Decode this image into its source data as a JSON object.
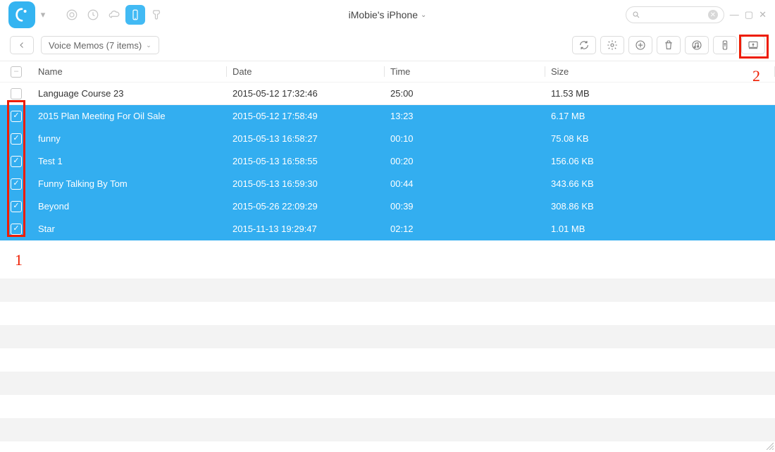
{
  "header": {
    "device_title": "iMobie's iPhone",
    "search_placeholder": ""
  },
  "breadcrumb": {
    "label": "Voice Memos (7 items)"
  },
  "columns": {
    "name": "Name",
    "date": "Date",
    "time": "Time",
    "size": "Size"
  },
  "annotations": {
    "label1": "1",
    "label2": "2"
  },
  "rows": [
    {
      "selected": false,
      "name": "Language Course 23",
      "date": "2015-05-12 17:32:46",
      "time": "25:00",
      "size": "11.53 MB"
    },
    {
      "selected": true,
      "name": "2015 Plan Meeting For Oil Sale",
      "date": "2015-05-12 17:58:49",
      "time": "13:23",
      "size": "6.17 MB"
    },
    {
      "selected": true,
      "name": "funny",
      "date": "2015-05-13 16:58:27",
      "time": "00:10",
      "size": "75.08 KB"
    },
    {
      "selected": true,
      "name": "Test 1",
      "date": "2015-05-13 16:58:55",
      "time": "00:20",
      "size": "156.06 KB"
    },
    {
      "selected": true,
      "name": "Funny Talking By Tom",
      "date": "2015-05-13 16:59:30",
      "time": "00:44",
      "size": "343.66 KB"
    },
    {
      "selected": true,
      "name": "Beyond",
      "date": "2015-05-26 22:09:29",
      "time": "00:39",
      "size": "308.86 KB"
    },
    {
      "selected": true,
      "name": "Star",
      "date": "2015-11-13 19:29:47",
      "time": "02:12",
      "size": "1.01 MB"
    }
  ]
}
